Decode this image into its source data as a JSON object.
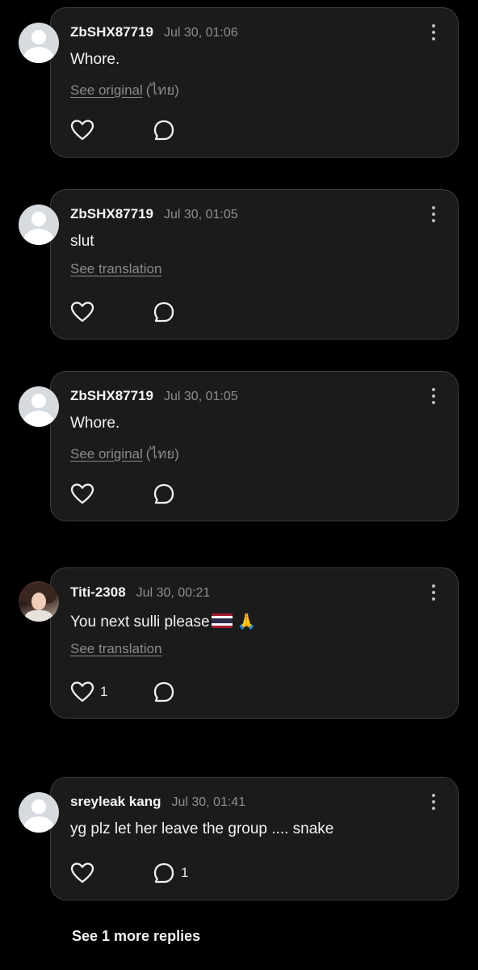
{
  "comments": [
    {
      "username": "ZbSHX87719",
      "time": "Jul 30, 01:06",
      "text": "Whore.",
      "link_label": "See original",
      "link_lang": "(ไทย)",
      "like_count": "",
      "reply_count": ""
    },
    {
      "username": "ZbSHX87719",
      "time": "Jul 30, 01:05",
      "text": "slut",
      "link_label": "See translation",
      "link_lang": "",
      "like_count": "",
      "reply_count": ""
    },
    {
      "username": "ZbSHX87719",
      "time": "Jul 30, 01:05",
      "text": "Whore.",
      "link_label": "See original",
      "link_lang": "(ไทย)",
      "like_count": "",
      "reply_count": ""
    },
    {
      "username": "Titi-2308",
      "time": "Jul 30, 00:21",
      "text": "You next sulli please",
      "emoji": "🙏",
      "link_label": "See translation",
      "link_lang": "",
      "like_count": "1",
      "reply_count": ""
    },
    {
      "username": "sreyleak kang",
      "time": "Jul 30, 01:41",
      "text": "yg plz let her leave the group .... snake",
      "link_label": "",
      "link_lang": "",
      "like_count": "",
      "reply_count": "1"
    }
  ],
  "more_replies_label": "See 1 more replies",
  "icons": {
    "avatar": "default-user-avatar",
    "like": "heart-outline-icon",
    "reply": "speech-bubble-icon",
    "more": "vertical-ellipsis-icon",
    "flag": "thailand-flag-emoji"
  },
  "colors": {
    "background": "#000000",
    "card": "#1b1b1b",
    "card_border": "#3c3c3c",
    "muted": "#8e8e8e"
  }
}
